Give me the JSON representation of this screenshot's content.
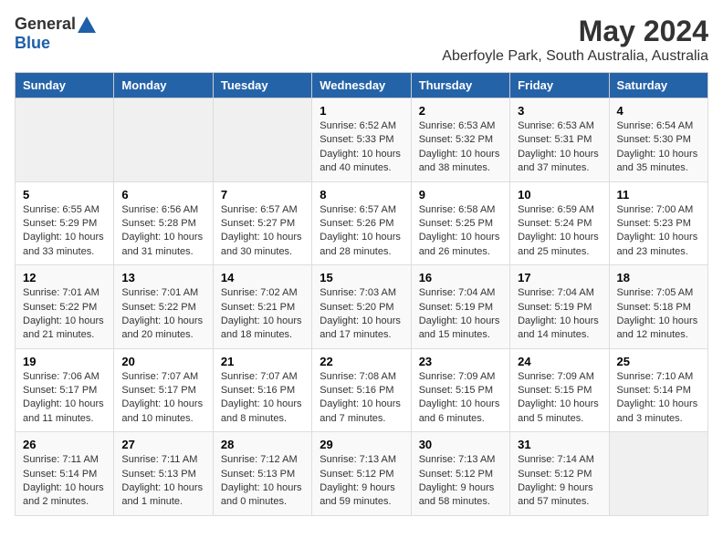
{
  "header": {
    "logo_general": "General",
    "logo_blue": "Blue",
    "month_year": "May 2024",
    "location": "Aberfoyle Park, South Australia, Australia"
  },
  "days_of_week": [
    "Sunday",
    "Monday",
    "Tuesday",
    "Wednesday",
    "Thursday",
    "Friday",
    "Saturday"
  ],
  "weeks": [
    [
      {
        "day": "",
        "info": ""
      },
      {
        "day": "",
        "info": ""
      },
      {
        "day": "",
        "info": ""
      },
      {
        "day": "1",
        "info": "Sunrise: 6:52 AM\nSunset: 5:33 PM\nDaylight: 10 hours\nand 40 minutes."
      },
      {
        "day": "2",
        "info": "Sunrise: 6:53 AM\nSunset: 5:32 PM\nDaylight: 10 hours\nand 38 minutes."
      },
      {
        "day": "3",
        "info": "Sunrise: 6:53 AM\nSunset: 5:31 PM\nDaylight: 10 hours\nand 37 minutes."
      },
      {
        "day": "4",
        "info": "Sunrise: 6:54 AM\nSunset: 5:30 PM\nDaylight: 10 hours\nand 35 minutes."
      }
    ],
    [
      {
        "day": "5",
        "info": "Sunrise: 6:55 AM\nSunset: 5:29 PM\nDaylight: 10 hours\nand 33 minutes."
      },
      {
        "day": "6",
        "info": "Sunrise: 6:56 AM\nSunset: 5:28 PM\nDaylight: 10 hours\nand 31 minutes."
      },
      {
        "day": "7",
        "info": "Sunrise: 6:57 AM\nSunset: 5:27 PM\nDaylight: 10 hours\nand 30 minutes."
      },
      {
        "day": "8",
        "info": "Sunrise: 6:57 AM\nSunset: 5:26 PM\nDaylight: 10 hours\nand 28 minutes."
      },
      {
        "day": "9",
        "info": "Sunrise: 6:58 AM\nSunset: 5:25 PM\nDaylight: 10 hours\nand 26 minutes."
      },
      {
        "day": "10",
        "info": "Sunrise: 6:59 AM\nSunset: 5:24 PM\nDaylight: 10 hours\nand 25 minutes."
      },
      {
        "day": "11",
        "info": "Sunrise: 7:00 AM\nSunset: 5:23 PM\nDaylight: 10 hours\nand 23 minutes."
      }
    ],
    [
      {
        "day": "12",
        "info": "Sunrise: 7:01 AM\nSunset: 5:22 PM\nDaylight: 10 hours\nand 21 minutes."
      },
      {
        "day": "13",
        "info": "Sunrise: 7:01 AM\nSunset: 5:22 PM\nDaylight: 10 hours\nand 20 minutes."
      },
      {
        "day": "14",
        "info": "Sunrise: 7:02 AM\nSunset: 5:21 PM\nDaylight: 10 hours\nand 18 minutes."
      },
      {
        "day": "15",
        "info": "Sunrise: 7:03 AM\nSunset: 5:20 PM\nDaylight: 10 hours\nand 17 minutes."
      },
      {
        "day": "16",
        "info": "Sunrise: 7:04 AM\nSunset: 5:19 PM\nDaylight: 10 hours\nand 15 minutes."
      },
      {
        "day": "17",
        "info": "Sunrise: 7:04 AM\nSunset: 5:19 PM\nDaylight: 10 hours\nand 14 minutes."
      },
      {
        "day": "18",
        "info": "Sunrise: 7:05 AM\nSunset: 5:18 PM\nDaylight: 10 hours\nand 12 minutes."
      }
    ],
    [
      {
        "day": "19",
        "info": "Sunrise: 7:06 AM\nSunset: 5:17 PM\nDaylight: 10 hours\nand 11 minutes."
      },
      {
        "day": "20",
        "info": "Sunrise: 7:07 AM\nSunset: 5:17 PM\nDaylight: 10 hours\nand 10 minutes."
      },
      {
        "day": "21",
        "info": "Sunrise: 7:07 AM\nSunset: 5:16 PM\nDaylight: 10 hours\nand 8 minutes."
      },
      {
        "day": "22",
        "info": "Sunrise: 7:08 AM\nSunset: 5:16 PM\nDaylight: 10 hours\nand 7 minutes."
      },
      {
        "day": "23",
        "info": "Sunrise: 7:09 AM\nSunset: 5:15 PM\nDaylight: 10 hours\nand 6 minutes."
      },
      {
        "day": "24",
        "info": "Sunrise: 7:09 AM\nSunset: 5:15 PM\nDaylight: 10 hours\nand 5 minutes."
      },
      {
        "day": "25",
        "info": "Sunrise: 7:10 AM\nSunset: 5:14 PM\nDaylight: 10 hours\nand 3 minutes."
      }
    ],
    [
      {
        "day": "26",
        "info": "Sunrise: 7:11 AM\nSunset: 5:14 PM\nDaylight: 10 hours\nand 2 minutes."
      },
      {
        "day": "27",
        "info": "Sunrise: 7:11 AM\nSunset: 5:13 PM\nDaylight: 10 hours\nand 1 minute."
      },
      {
        "day": "28",
        "info": "Sunrise: 7:12 AM\nSunset: 5:13 PM\nDaylight: 10 hours\nand 0 minutes."
      },
      {
        "day": "29",
        "info": "Sunrise: 7:13 AM\nSunset: 5:12 PM\nDaylight: 9 hours\nand 59 minutes."
      },
      {
        "day": "30",
        "info": "Sunrise: 7:13 AM\nSunset: 5:12 PM\nDaylight: 9 hours\nand 58 minutes."
      },
      {
        "day": "31",
        "info": "Sunrise: 7:14 AM\nSunset: 5:12 PM\nDaylight: 9 hours\nand 57 minutes."
      },
      {
        "day": "",
        "info": ""
      }
    ]
  ]
}
